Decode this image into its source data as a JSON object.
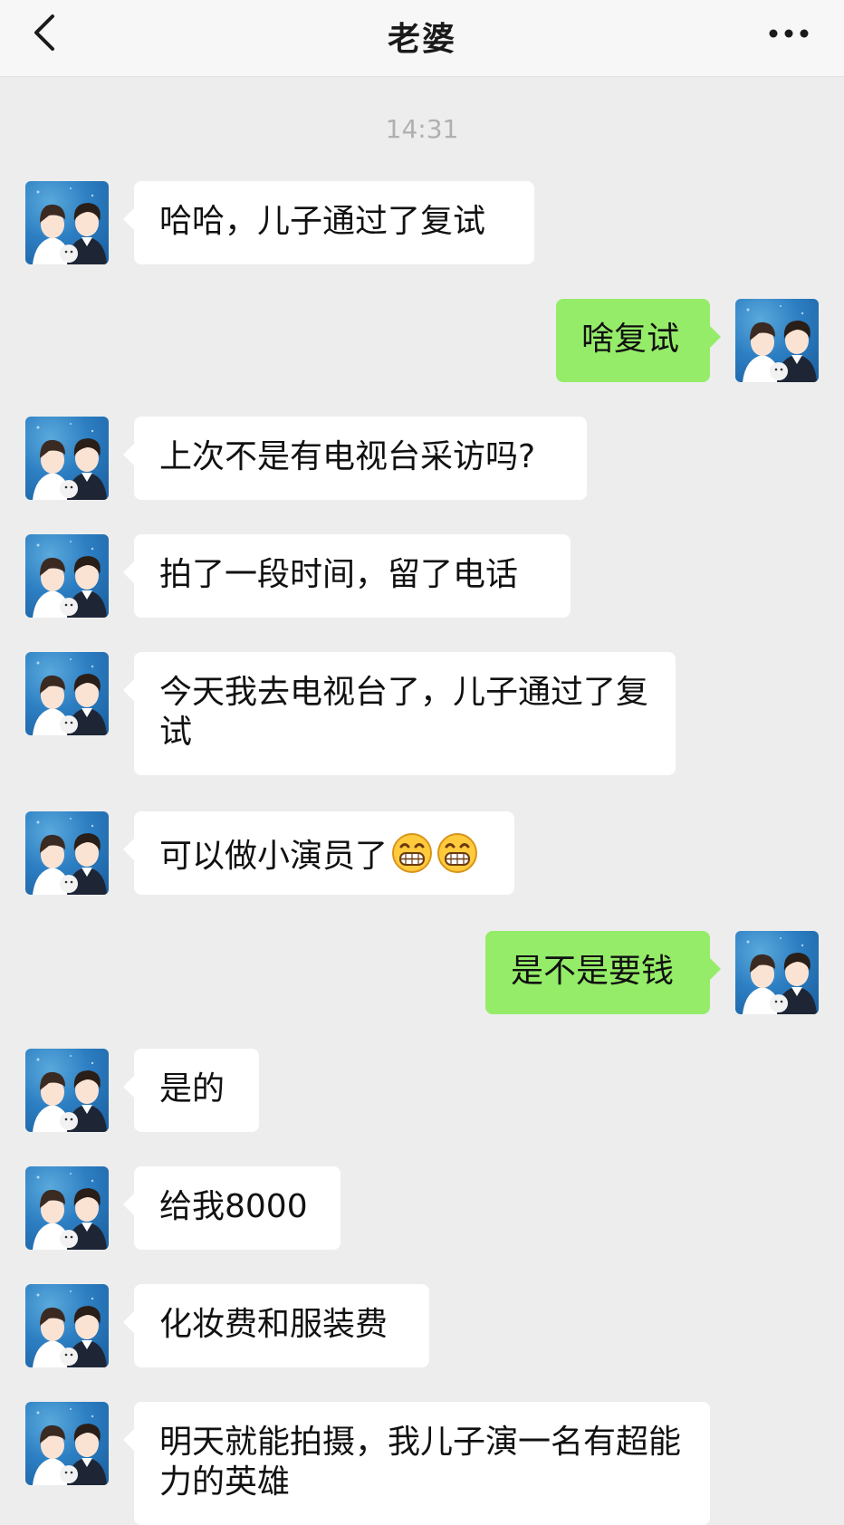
{
  "header": {
    "title": "老婆"
  },
  "timestamp": "14:31",
  "messages": [
    {
      "side": "left",
      "text": "哈哈，儿子通过了复试"
    },
    {
      "side": "right",
      "text": "啥复试"
    },
    {
      "side": "left",
      "text": "上次不是有电视台采访吗?"
    },
    {
      "side": "left",
      "text": "拍了一段时间，留了电话"
    },
    {
      "side": "left",
      "text": "今天我去电视台了，儿子通过了复试"
    },
    {
      "side": "left",
      "text": "可以做小演员了",
      "emoji": [
        "grin-emoji",
        "grin-emoji"
      ]
    },
    {
      "side": "right",
      "text": "是不是要钱"
    },
    {
      "side": "left",
      "text": "是的"
    },
    {
      "side": "left",
      "text": "给我8000"
    },
    {
      "side": "left",
      "text": "化妆费和服装费"
    },
    {
      "side": "left",
      "text": "明天就能拍摄，我儿子演一名有超能力的英雄"
    }
  ],
  "colors": {
    "background": "#EDEDED",
    "header": "#F7F7F7",
    "sent_bubble": "#95EC69",
    "received_bubble": "#FFFFFF"
  }
}
